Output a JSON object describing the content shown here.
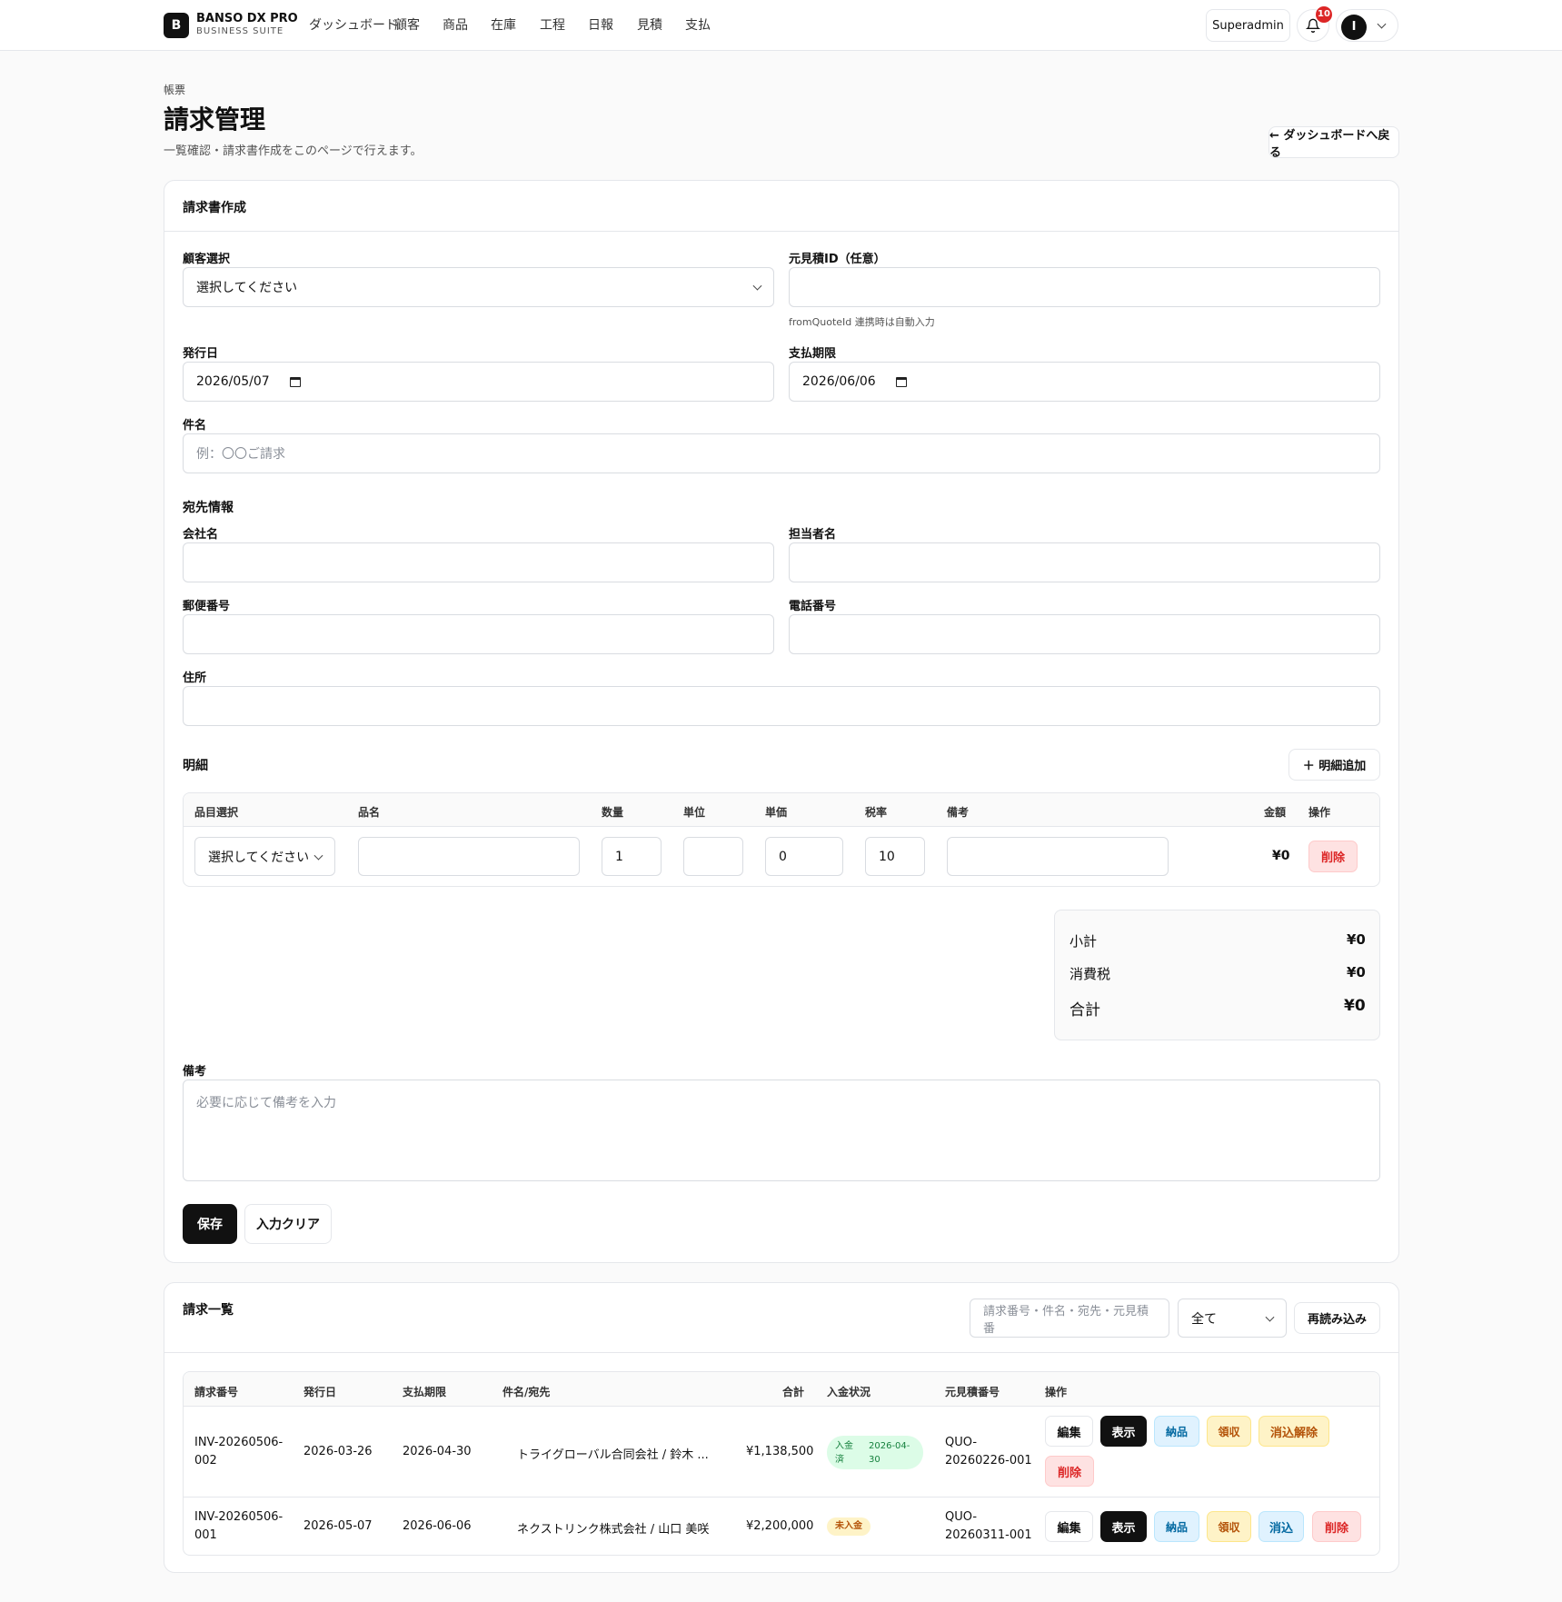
{
  "app": {
    "brand": "BANSO DX PRO",
    "brand_sub": "BUSINESS SUITE",
    "logo_letter": "B"
  },
  "nav": [
    "ダッシュボード",
    "顧客",
    "商品",
    "在庫",
    "工程",
    "日報",
    "見積",
    "支払"
  ],
  "header": {
    "role": "Superadmin",
    "notification_count": "10",
    "avatar_letter": "I"
  },
  "page": {
    "breadcrumb": "帳票",
    "title": "請求管理",
    "description": "一覧確認・請求書作成をこのページで行えます。",
    "back_button": "← ダッシュボードへ戻る"
  },
  "form": {
    "title": "請求書作成",
    "customer_label": "顧客選択",
    "customer_value": "選択してください",
    "quote_id_label": "元見積ID（任意）",
    "quote_id_hint": "fromQuoteId 連携時は自動入力",
    "issue_date_label": "発行日",
    "issue_date_value": "2026/05/07",
    "due_date_label": "支払期限",
    "due_date_value": "2026/06/06",
    "subject_label": "件名",
    "subject_placeholder": "例：〇〇ご請求",
    "recipient_section": "宛先情報",
    "company_label": "会社名",
    "contact_label": "担当者名",
    "postal_label": "郵便番号",
    "phone_label": "電話番号",
    "address_label": "住所",
    "details_section": "明細",
    "add_line_button": "＋ 明細追加",
    "line_headers": {
      "item_select": "品目選択",
      "name": "品名",
      "qty": "数量",
      "unit": "単位",
      "price": "単価",
      "tax": "税率",
      "note": "備考",
      "amount": "金額",
      "action": "操作"
    },
    "line": {
      "item_value": "選択してください",
      "qty": "1",
      "price": "0",
      "tax": "10",
      "amount": "¥0",
      "delete": "削除"
    },
    "totals": {
      "subtotal_label": "小計",
      "subtotal": "¥0",
      "tax_label": "消費税",
      "tax": "¥0",
      "total_label": "合計",
      "total": "¥0"
    },
    "notes_label": "備考",
    "notes_placeholder": "必要に応じて備考を入力",
    "save_button": "保存",
    "clear_button": "入力クリア"
  },
  "list": {
    "title": "請求一覧",
    "search_placeholder": "請求番号・件名・宛先・元見積番",
    "filter_value": "全て",
    "reload_button": "再読み込み",
    "headers": {
      "number": "請求番号",
      "issue": "発行日",
      "due": "支払期限",
      "subject": "件名/宛先",
      "total": "合計",
      "status": "入金状況",
      "quote": "元見積番号",
      "actions": "操作"
    },
    "rows": [
      {
        "number_a": "INV-20260506-",
        "number_b": "002",
        "issue": "2026-03-26",
        "due": "2026-04-30",
        "subject": "トライグローバル合同会社 / 鈴木 ...",
        "total": "¥1,138,500",
        "status_a": "入金",
        "status_b": "済",
        "status_date_a": "2026-04-",
        "status_date_b": "30",
        "quote_a": "QUO-",
        "quote_b": "20260226-001",
        "actions": {
          "edit": "編集",
          "view": "表示",
          "deliver": "納品",
          "receipt": "領収",
          "cancel": "消込解除",
          "delete": "削除"
        }
      },
      {
        "number_a": "INV-20260506-",
        "number_b": "001",
        "issue": "2026-05-07",
        "due": "2026-06-06",
        "subject": "ネクストリンク株式会社 / 山口 美咲",
        "total": "¥2,200,000",
        "status": "未入金",
        "quote_a": "QUO-",
        "quote_b": "20260311-001",
        "actions": {
          "edit": "編集",
          "view": "表示",
          "deliver": "納品",
          "receipt": "領収",
          "reconcile": "消込",
          "delete": "削除"
        }
      }
    ]
  },
  "colors": {
    "primary": "#111111",
    "danger": "#dc2626",
    "info": "#0369a1",
    "warning": "#b45309",
    "success": "#15803d"
  }
}
